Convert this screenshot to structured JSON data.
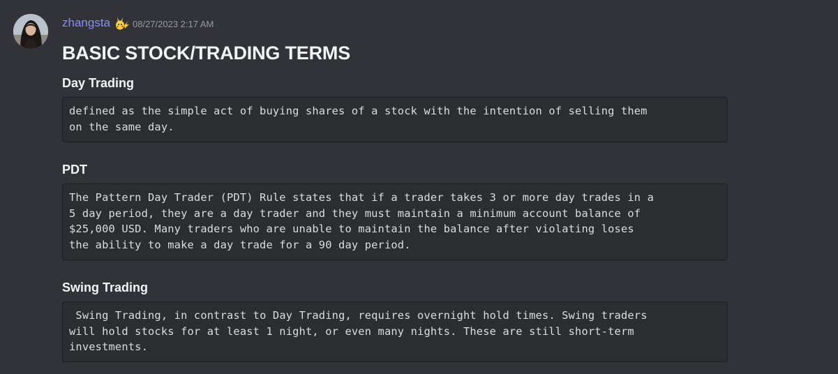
{
  "message": {
    "author": "zhangsta",
    "timestamp": "08/27/2023 2:17 AM",
    "heading": "BASIC STOCK/TRADING TERMS",
    "sections": [
      {
        "title": "Day Trading",
        "body": "defined as the simple act of buying shares of a stock with the intention of selling them\non the same day."
      },
      {
        "title": "PDT",
        "body": "The Pattern Day Trader (PDT) Rule states that if a trader takes 3 or more day trades in a\n5 day period, they are a day trader and they must maintain a minimum account balance of\n$25,000 USD. Many traders who are unable to maintain the balance after violating loses\nthe ability to make a day trade for a 90 day period."
      },
      {
        "title": "Swing Trading",
        "body": " Swing Trading, in contrast to Day Trading, requires overnight hold times. Swing traders\nwill hold stocks for at least 1 night, or even many nights. These are still short-term\ninvestments."
      }
    ]
  },
  "icons": {
    "avatar": "user-avatar",
    "badge": "pikachu-badge-icon"
  },
  "colors": {
    "background": "#313338",
    "username": "#8c8ef5",
    "timestamp": "#949ba4",
    "code_background": "#2b2d31"
  }
}
